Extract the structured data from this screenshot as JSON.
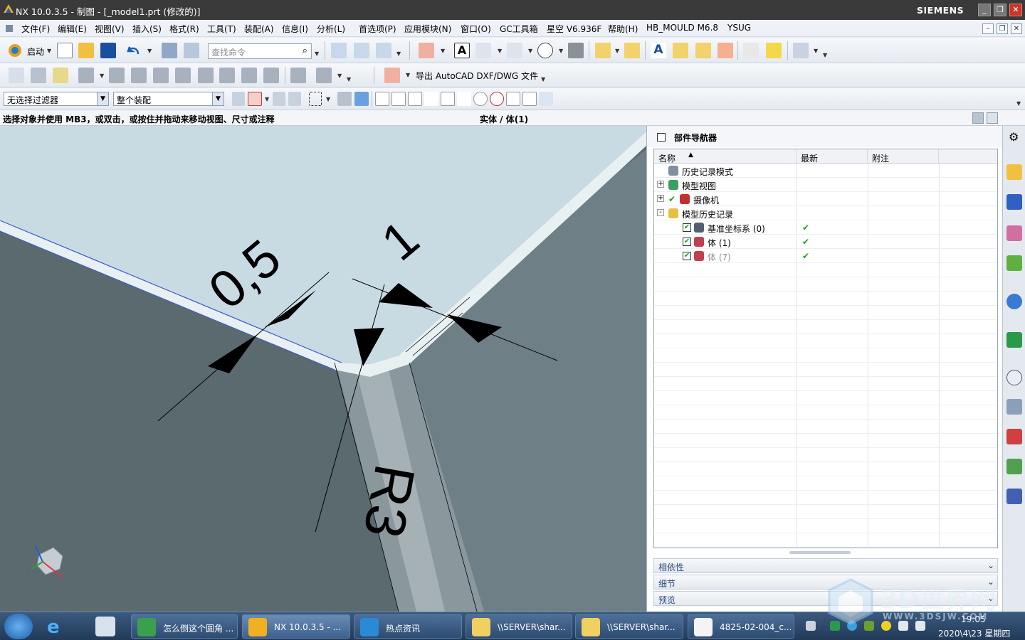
{
  "titlebar": {
    "title": "NX 10.0.3.5 - 制图 - [_model1.prt (修改的)]",
    "brand": "SIEMENS",
    "minimize": "_",
    "restore": "❐",
    "close": "✕"
  },
  "menubar": {
    "items": [
      "文件(F)",
      "编辑(E)",
      "视图(V)",
      "插入(S)",
      "格式(R)",
      "工具(T)",
      "装配(A)",
      "信息(I)",
      "分析(L)",
      "首选项(P)",
      "应用模块(N)",
      "窗口(O)",
      "GC工具箱",
      "星空 V6.936F",
      "帮助(H)",
      "HB_MOULD M6.8",
      "YSUG"
    ]
  },
  "toolbar1": {
    "start_label": "启动",
    "search_placeholder": "查找命令"
  },
  "toolbar2": {
    "export_label": "导出 AutoCAD DXF/DWG 文件"
  },
  "toolbar3": {
    "filter_value": "无选择过滤器",
    "scope_value": "整个装配"
  },
  "status": {
    "prompt": "选择对象并使用 MB3，或双击，或按住并拖动来移动视图、尺寸或注释",
    "selection": "实体 / 体(1)"
  },
  "viewport": {
    "dim_a": "0,5",
    "dim_b": "1",
    "dim_r": "R3"
  },
  "navigator": {
    "title": "部件导航器",
    "columns": [
      "名称",
      "最新",
      "附注"
    ],
    "rows": [
      {
        "name": "历史记录模式",
        "latest": "",
        "note": "",
        "indent": 0,
        "icon": "history-icon",
        "expander": ""
      },
      {
        "name": "模型视图",
        "latest": "",
        "note": "",
        "indent": 0,
        "icon": "model-view-icon",
        "expander": "+"
      },
      {
        "name": "摄像机",
        "latest": "",
        "note": "",
        "indent": 0,
        "icon": "camera-icon",
        "expander": "+"
      },
      {
        "name": "模型历史记录",
        "latest": "",
        "note": "",
        "indent": 0,
        "icon": "folder-icon",
        "expander": "-"
      },
      {
        "name": "基准坐标系 (0)",
        "latest": "✔",
        "note": "",
        "indent": 1,
        "icon": "datum-csys-icon",
        "expander": ""
      },
      {
        "name": "体 (1)",
        "latest": "✔",
        "note": "",
        "indent": 1,
        "icon": "body-icon",
        "expander": ""
      },
      {
        "name": "体 (7)",
        "latest": "✔",
        "note": "",
        "indent": 1,
        "icon": "body-icon",
        "expander": "",
        "dim": true
      }
    ],
    "panels": [
      "相依性",
      "细节",
      "预览"
    ]
  },
  "taskbar": {
    "tasks": [
      "怎么倒这个圆角 ...",
      "NX 10.0.3.5 - ...",
      "热点资讯",
      "\\\\SERVER\\shar...",
      "\\\\SERVER\\shar...",
      "4825-02-004_c..."
    ],
    "time": "19:05",
    "date": "2020\\4\\23 星期四"
  },
  "watermark": {
    "text": "3D世界网",
    "url": "WWW.3DSJW.COM"
  },
  "colors": {
    "title_bg": "#3a3a3a",
    "part_face": "#c9dbe2",
    "part_side": "#5a6a6e",
    "check_green": "#1f9d1f",
    "taskbar": "#2e4c72"
  }
}
